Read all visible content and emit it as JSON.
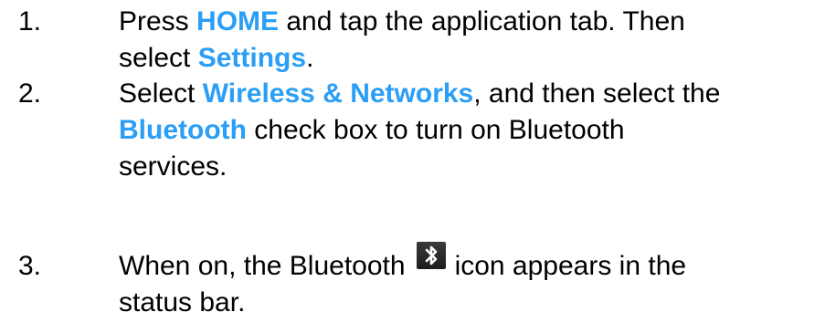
{
  "steps": [
    {
      "number": "1.",
      "line1": {
        "t1": "Press ",
        "h1": "HOME",
        "t2": " and tap the application tab. Then"
      },
      "line2": {
        "t1": "select ",
        "h1": "Settings",
        "t2": "."
      }
    },
    {
      "number": "2.",
      "line1": {
        "t1": "Select ",
        "h1": "Wireless & Networks",
        "t2": ", and then select the"
      },
      "line2": {
        "h1": "Bluetooth",
        "t1": " check box to turn on Bluetooth"
      },
      "line3": {
        "t1": "services."
      }
    },
    {
      "number": "3.",
      "line1": {
        "t1": "When on, the Bluetooth",
        "icon": "bluetooth-icon",
        "t2": "icon appears in the"
      },
      "line2": {
        "t1": "status bar."
      }
    }
  ],
  "colors": {
    "highlight": "#2b9ef5",
    "text": "#000000",
    "icon_bg": "#2a2a2a"
  }
}
